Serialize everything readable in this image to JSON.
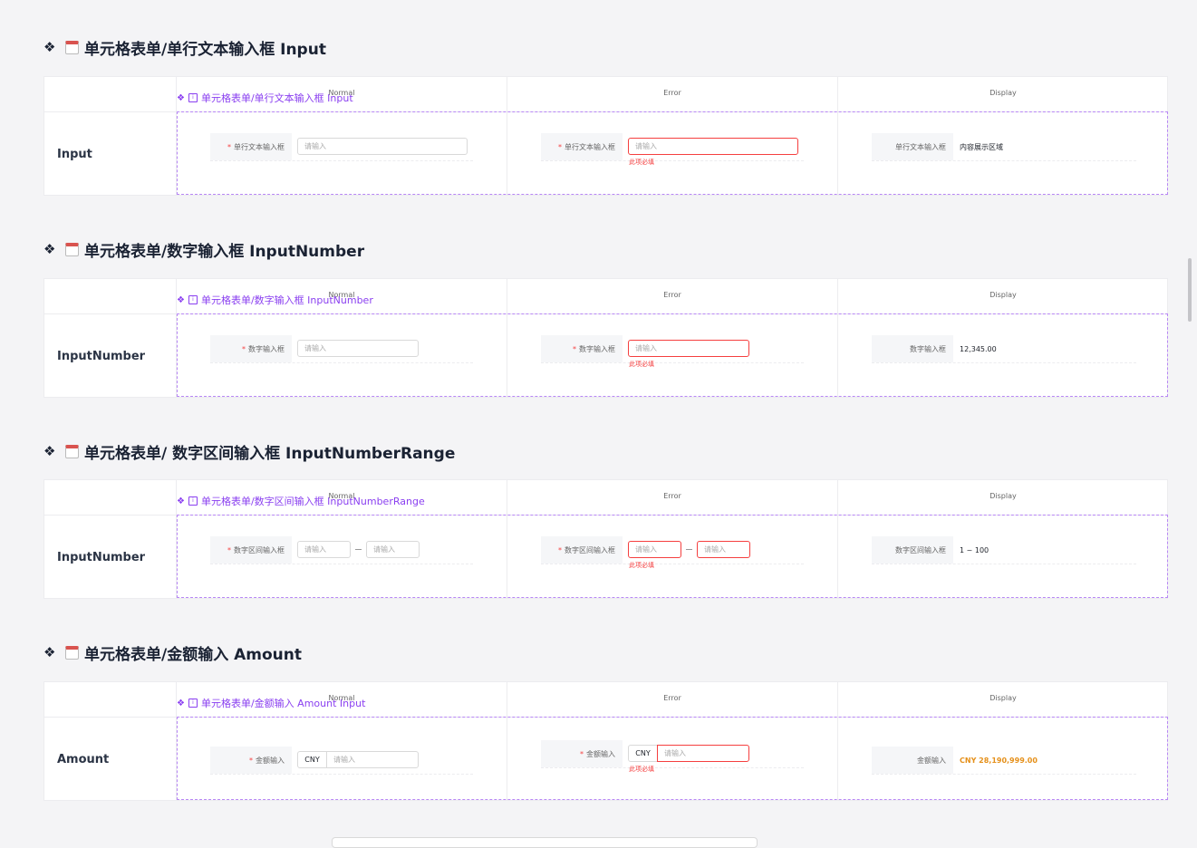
{
  "sections": [
    {
      "title": "单元格表单/单行文本输入框 Input",
      "component_label": "单元格表单/单行文本输入框 Input",
      "row_label": "Input",
      "columns": [
        "Normal",
        "Error",
        "Display"
      ],
      "field_label": "单行文本输入框",
      "placeholder": "请输入",
      "error_text": "此项必填",
      "display_label": "单行文本输入框",
      "display_value": "内容展示区域"
    },
    {
      "title": "单元格表单/数字输入框 InputNumber",
      "component_label": "单元格表单/数字输入框 InputNumber",
      "row_label": "InputNumber",
      "columns": [
        "Normal",
        "Error",
        "Display"
      ],
      "field_label": "数字输入框",
      "placeholder": "请输入",
      "error_text": "此项必填",
      "display_label": "数字输入框",
      "display_value": "12,345.00"
    },
    {
      "title": "单元格表单/ 数字区间输入框 InputNumberRange",
      "component_label": "单元格表单/数字区间输入框 InputNumberRange",
      "row_label": "InputNumber",
      "columns": [
        "Normal",
        "Error",
        "Display"
      ],
      "field_label": "数字区间输入框",
      "placeholder": "请输入",
      "error_text": "此项必填",
      "display_label": "数字区间输入框",
      "display_value": "1 ~ 100"
    },
    {
      "title": "单元格表单/金额输入 Amount",
      "component_label": "单元格表单/金额输入 Amount Input",
      "row_label": "Amount",
      "columns": [
        "Normal",
        "Error",
        "Display"
      ],
      "field_label": "金额输入",
      "currency": "CNY",
      "placeholder": "请输入",
      "error_text": "此项必填",
      "display_label": "金额输入",
      "display_value": "CNY 28,190,999.00"
    }
  ],
  "icons": [
    "diamond-icon",
    "calendar-icon"
  ],
  "colors": {
    "accent": "#8a3ff0",
    "error": "#f53f3f",
    "amount": "#e5901a",
    "title": "#1a2233"
  }
}
